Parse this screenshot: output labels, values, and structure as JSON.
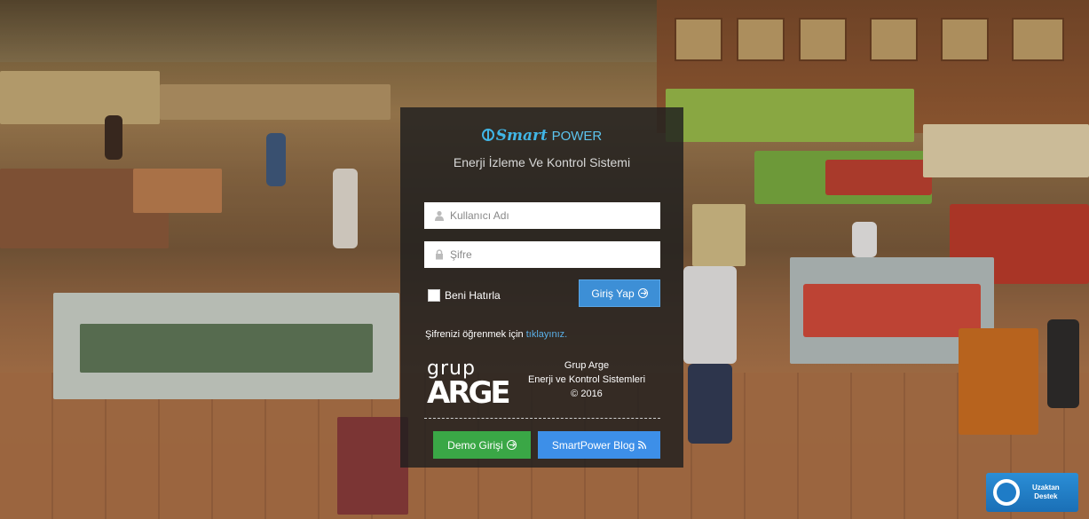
{
  "brand": {
    "smart": "Smart",
    "power": "POWER",
    "subtitle": "Enerji İzleme Ve Kontrol Sistemi"
  },
  "form": {
    "username_placeholder": "Kullanıcı Adı",
    "password_placeholder": "Şifre",
    "remember_label": "Beni Hatırla",
    "login_button": "Giriş Yap",
    "forgot_prefix": "Şifrenizi öğrenmek için ",
    "forgot_link": "tıklayınız."
  },
  "company": {
    "logo_top": "grup",
    "logo_bottom": "ARGE",
    "line1": "Grup Arge",
    "line2": "Enerji ve Kontrol Sistemleri",
    "line3": "© 2016"
  },
  "actions": {
    "demo_button": "Demo Girişi",
    "blog_button": "SmartPower Blog"
  },
  "support": {
    "line1": "Uzaktan",
    "line2": "Destek"
  },
  "colors": {
    "accent_blue": "#3d8fd6",
    "demo_green": "#3aa746",
    "brand_blue": "#41b6e6"
  }
}
